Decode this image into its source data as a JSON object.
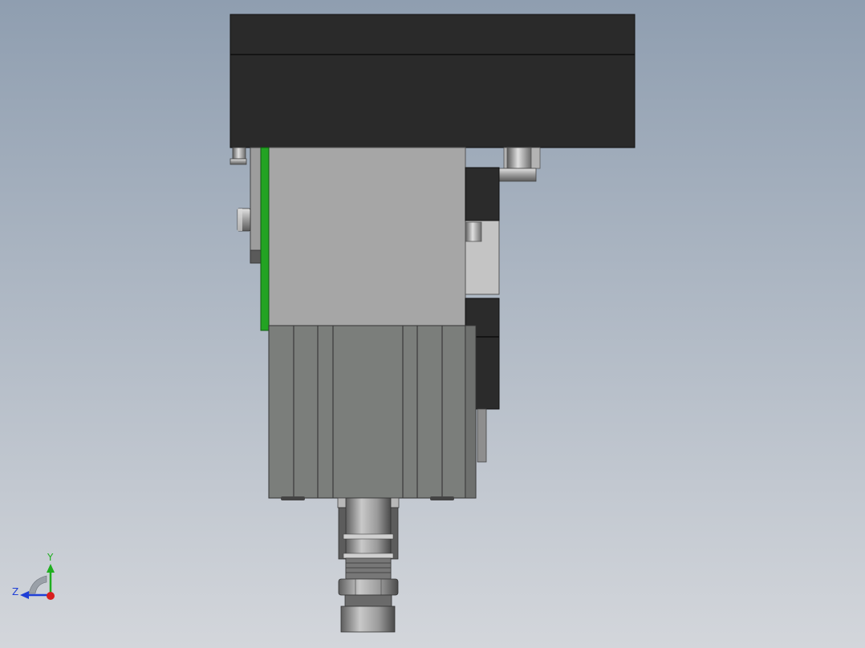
{
  "viewport": {
    "background_top": "#8f9eb0",
    "background_bottom": "#d3d6db"
  },
  "triad": {
    "y_label": "Y",
    "z_label": "Z",
    "y_color": "#1fae1f",
    "z_color": "#1f3fd6",
    "x_color": "#d81e1e"
  },
  "colors": {
    "dark_block": "#2a2a2a",
    "body_gray": "#a6a6a6",
    "cylinder_gray": "#7b7e7b",
    "green_plate": "#23a323",
    "steel": "#8f8f8f"
  }
}
